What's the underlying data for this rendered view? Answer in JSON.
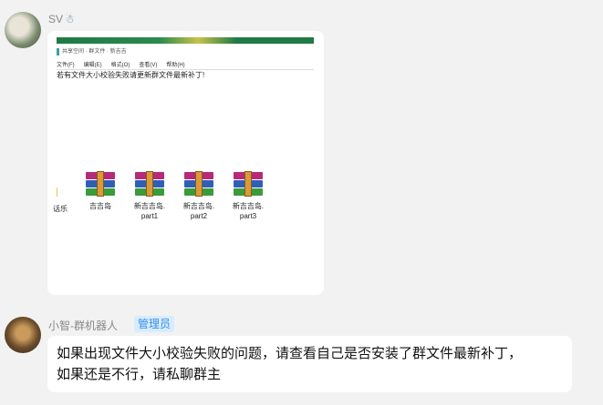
{
  "messages": [
    {
      "sender": "SV",
      "sender_icon": "snowman-icon",
      "type": "image",
      "image": {
        "breadcrumb": "共享空间 · 群文件 · 新吉吉",
        "menu": [
          "文件(F)",
          "编辑(E)",
          "格式(O)",
          "查看(V)",
          "帮助(H)"
        ],
        "notice": "若有文件大小校验失败请更新群文件最新补丁!",
        "cut_label": "话乐",
        "files": [
          {
            "name_line1": "吉吉岛",
            "name_line2": ""
          },
          {
            "name_line1": "新吉吉岛.",
            "name_line2": "part1"
          },
          {
            "name_line1": "新吉吉岛.",
            "name_line2": "part2"
          },
          {
            "name_line1": "新吉吉岛.",
            "name_line2": "part3"
          }
        ]
      }
    },
    {
      "sender": "小智-群机器人",
      "badge": "管理员",
      "type": "text",
      "text_line1": "如果出现文件大小校验失败的问题，请查看自己是否安装了群文件最新补丁，",
      "text_line2": "如果还是不行，请私聊群主"
    }
  ],
  "colors": {
    "background": "#f2f2f2",
    "bubble": "#ffffff",
    "badge_bg": "#d7ecff",
    "badge_text": "#3a8ee6",
    "sender_text": "#888888"
  }
}
